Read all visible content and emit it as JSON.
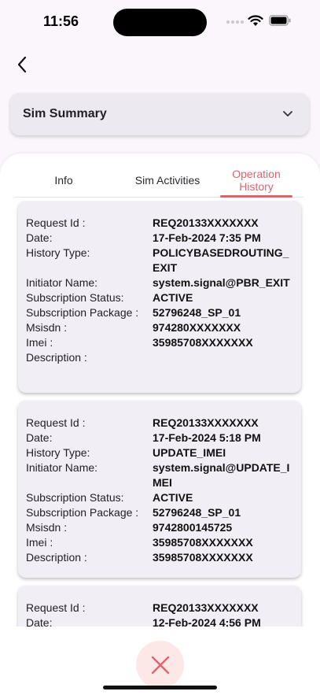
{
  "status_bar": {
    "time": "11:56"
  },
  "summary": {
    "title": "Sim Summary"
  },
  "tabs": [
    {
      "label": "Info"
    },
    {
      "label": "Sim Activities"
    },
    {
      "label": "Operation History"
    }
  ],
  "active_color": "#e0636c",
  "labels": {
    "request_id": "Request Id :",
    "date": "Date:",
    "history_type": "History Type:",
    "initiator_name": "Initiator Name:",
    "subscription_status": "Subscription Status:",
    "subscription_package": "Subscription Package :",
    "msisdn": "Msisdn :",
    "imei": "Imei :",
    "description": "Description :"
  },
  "history": [
    {
      "request_id": "REQ20133XXXXXXX",
      "date": "17-Feb-2024 7:35 PM",
      "history_type": "POLICYBASEDROUTING_EXIT",
      "initiator_name": "system.signal@PBR_EXIT",
      "subscription_status": "ACTIVE",
      "subscription_package": "52796248_SP_01",
      "msisdn": "974280XXXXXXX",
      "imei": "35985708XXXXXXX",
      "description": ""
    },
    {
      "request_id": "REQ20133XXXXXXX",
      "date": "17-Feb-2024 5:18 PM",
      "history_type": "UPDATE_IMEI",
      "initiator_name": "system.signal@UPDATE_IMEI",
      "subscription_status": "ACTIVE",
      "subscription_package": "52796248_SP_01",
      "msisdn": "9742800145725",
      "imei": "35985708XXXXXXX",
      "description": "35985708XXXXXXX"
    },
    {
      "request_id": "REQ20133XXXXXXX",
      "date": "12-Feb-2024 4:56 PM"
    }
  ]
}
